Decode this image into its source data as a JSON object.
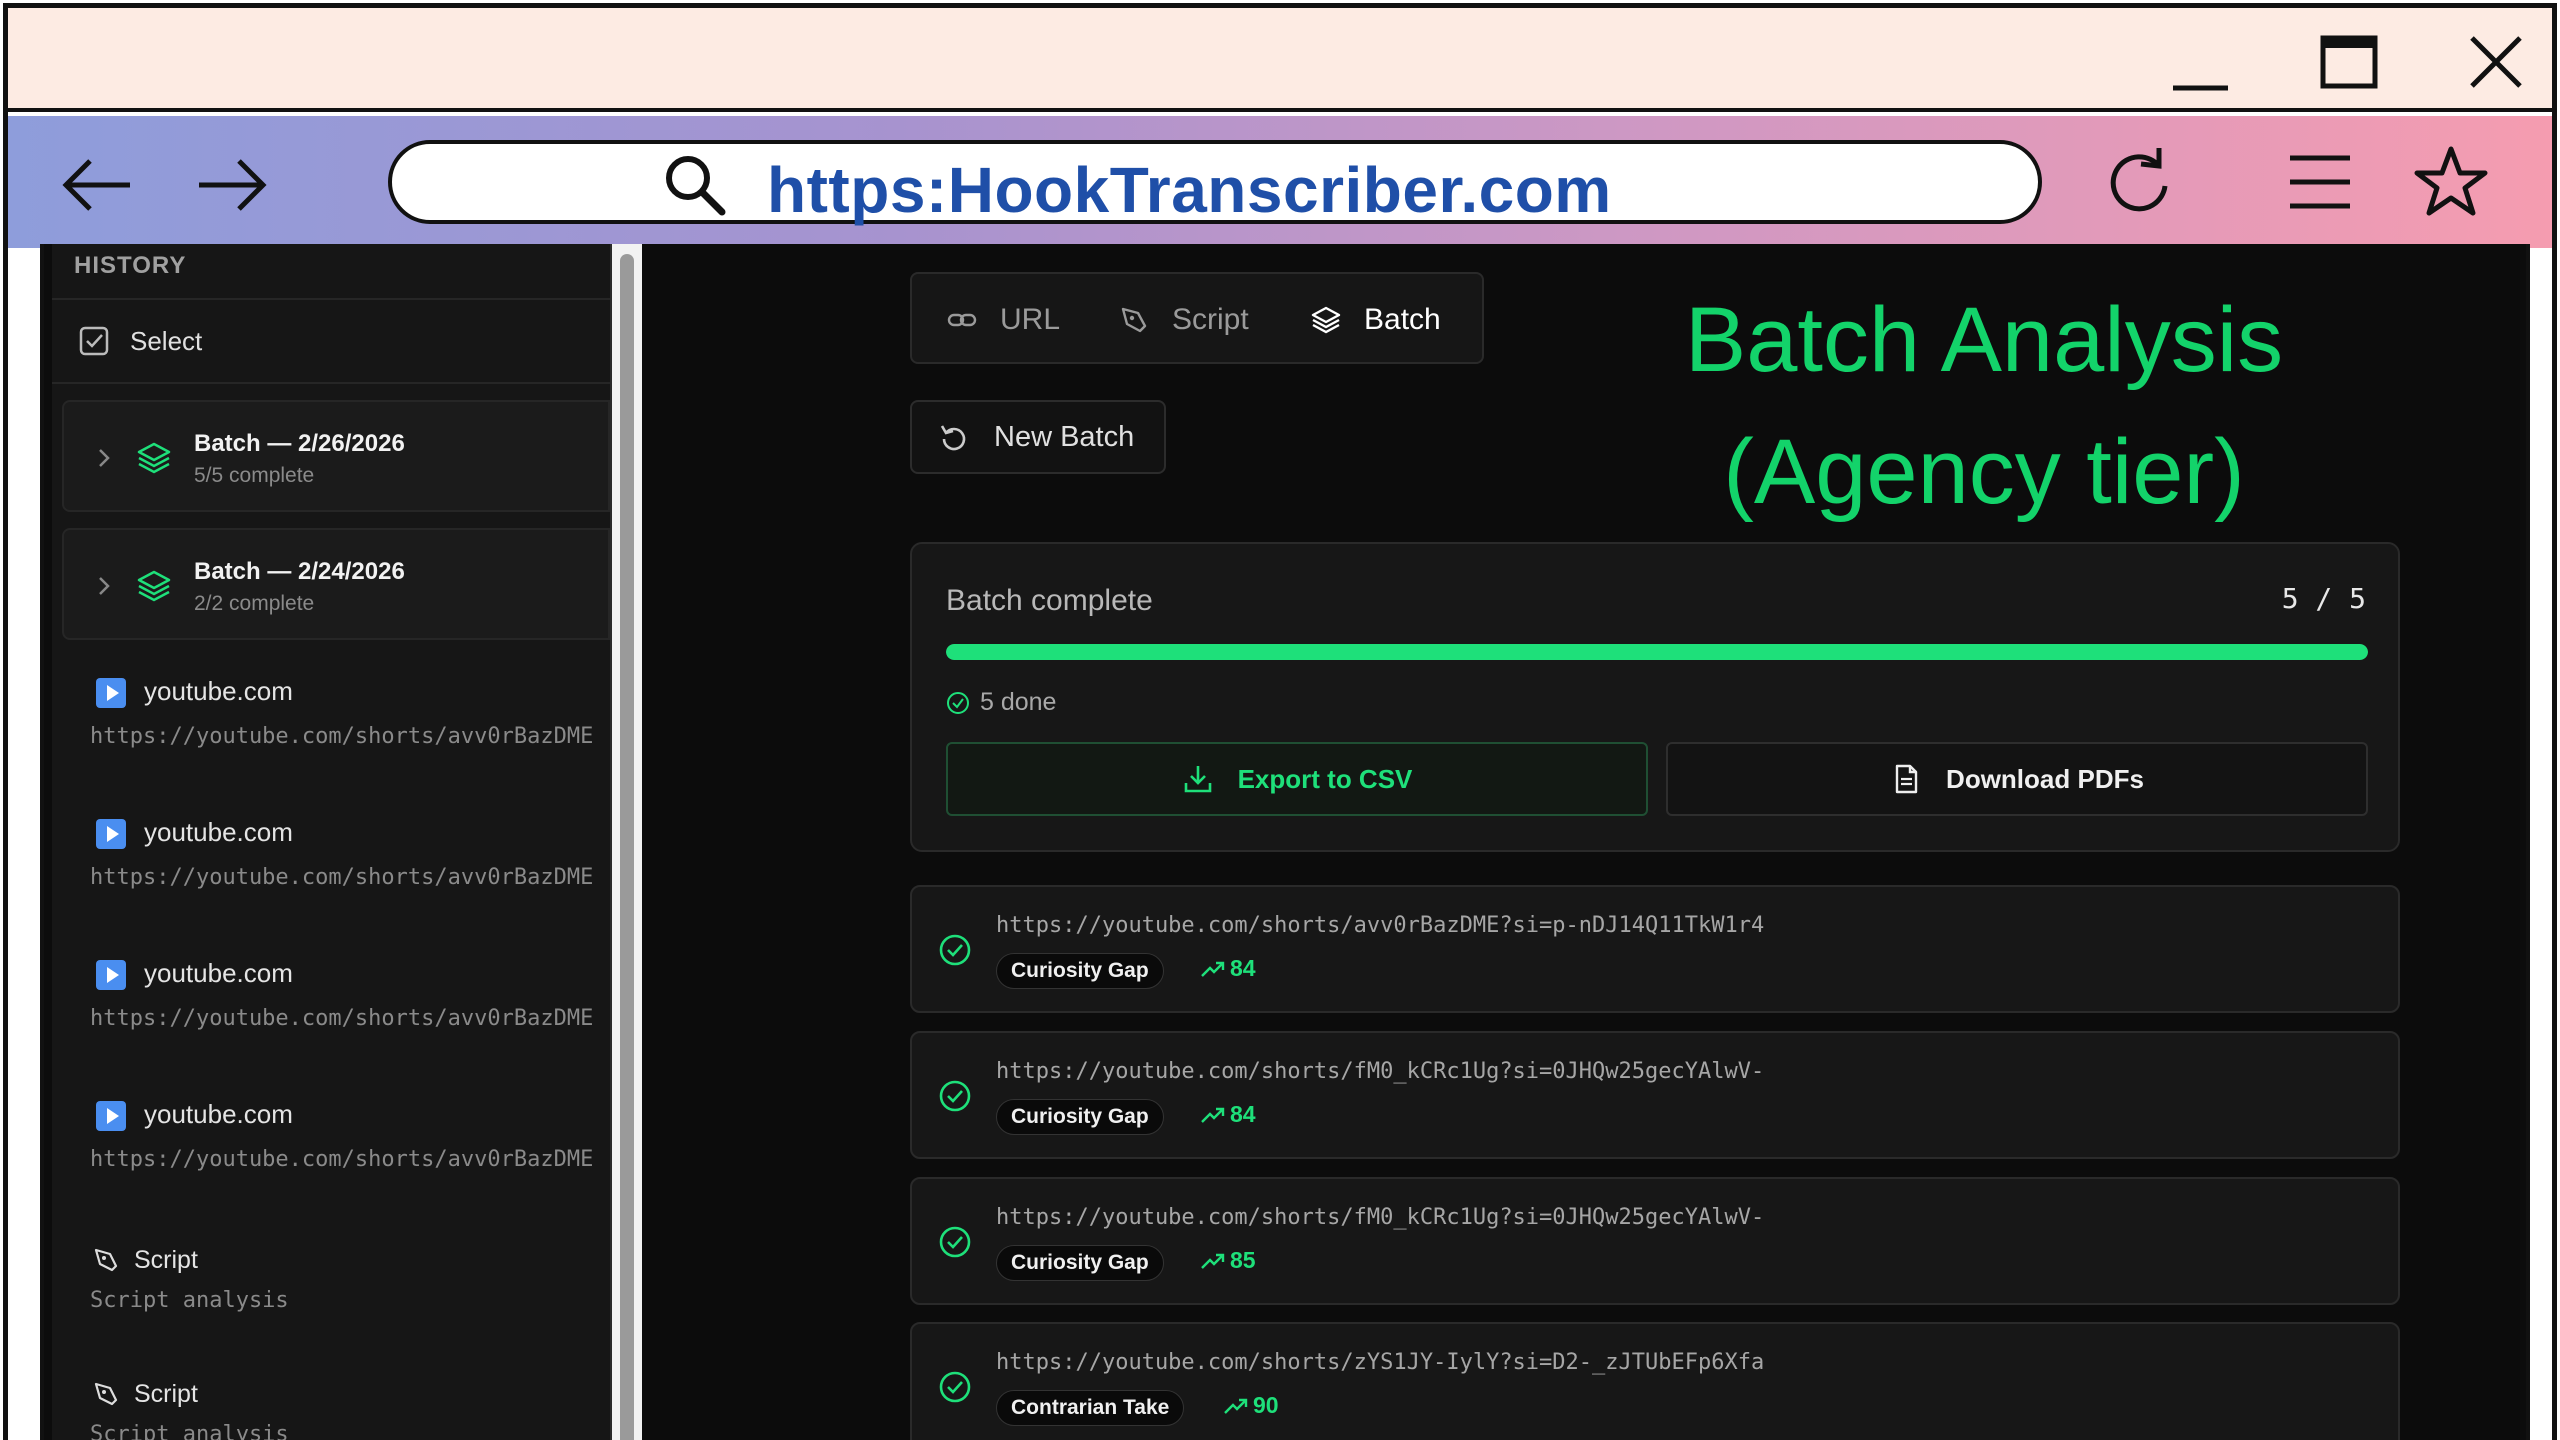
{
  "browser": {
    "url": "https:HookTranscriber.com"
  },
  "sidebar": {
    "heading": "HISTORY",
    "select_label": "Select",
    "batches": [
      {
        "title": "Batch — 2/26/2026",
        "status": "5/5 complete"
      },
      {
        "title": "Batch — 2/24/2026",
        "status": "2/2 complete"
      }
    ],
    "history": [
      {
        "site": "youtube.com",
        "url": "https://youtube.com/shorts/avv0rBazDME"
      },
      {
        "site": "youtube.com",
        "url": "https://youtube.com/shorts/avv0rBazDME"
      },
      {
        "site": "youtube.com",
        "url": "https://youtube.com/shorts/avv0rBazDME"
      },
      {
        "site": "youtube.com",
        "url": "https://youtube.com/shorts/avv0rBazDME"
      }
    ],
    "scripts": [
      {
        "title": "Script",
        "subtitle": "Script analysis"
      },
      {
        "title": "Script",
        "subtitle": "Script analysis"
      }
    ]
  },
  "tabs": {
    "url": "URL",
    "script": "Script",
    "batch": "Batch",
    "active": "batch"
  },
  "new_batch_label": "New Batch",
  "promo": {
    "line1": "Batch Analysis",
    "line2": "(Agency tier)"
  },
  "progress": {
    "title": "Batch complete",
    "count": "5 / 5",
    "fraction": 1.0,
    "done_label": "5 done",
    "export_label": "Export to CSV",
    "download_label": "Download PDFs"
  },
  "results": [
    {
      "url": "https://youtube.com/shorts/avv0rBazDME?si=p-nDJ14Q11TkW1r4",
      "hook": "Curiosity Gap",
      "score": "84"
    },
    {
      "url": "https://youtube.com/shorts/fM0_kCRc1Ug?si=0JHQw25gecYAlwV-",
      "hook": "Curiosity Gap",
      "score": "84"
    },
    {
      "url": "https://youtube.com/shorts/fM0_kCRc1Ug?si=0JHQw25gecYAlwV-",
      "hook": "Curiosity Gap",
      "score": "85"
    },
    {
      "url": "https://youtube.com/shorts/zYS1JY-IylY?si=D2-_zJTUbEFp6Xfa",
      "hook": "Contrarian Take",
      "score": "90"
    }
  ],
  "colors": {
    "accent": "#1ee07a",
    "promo": "#13d36a",
    "url_text": "#1f4fa8"
  }
}
